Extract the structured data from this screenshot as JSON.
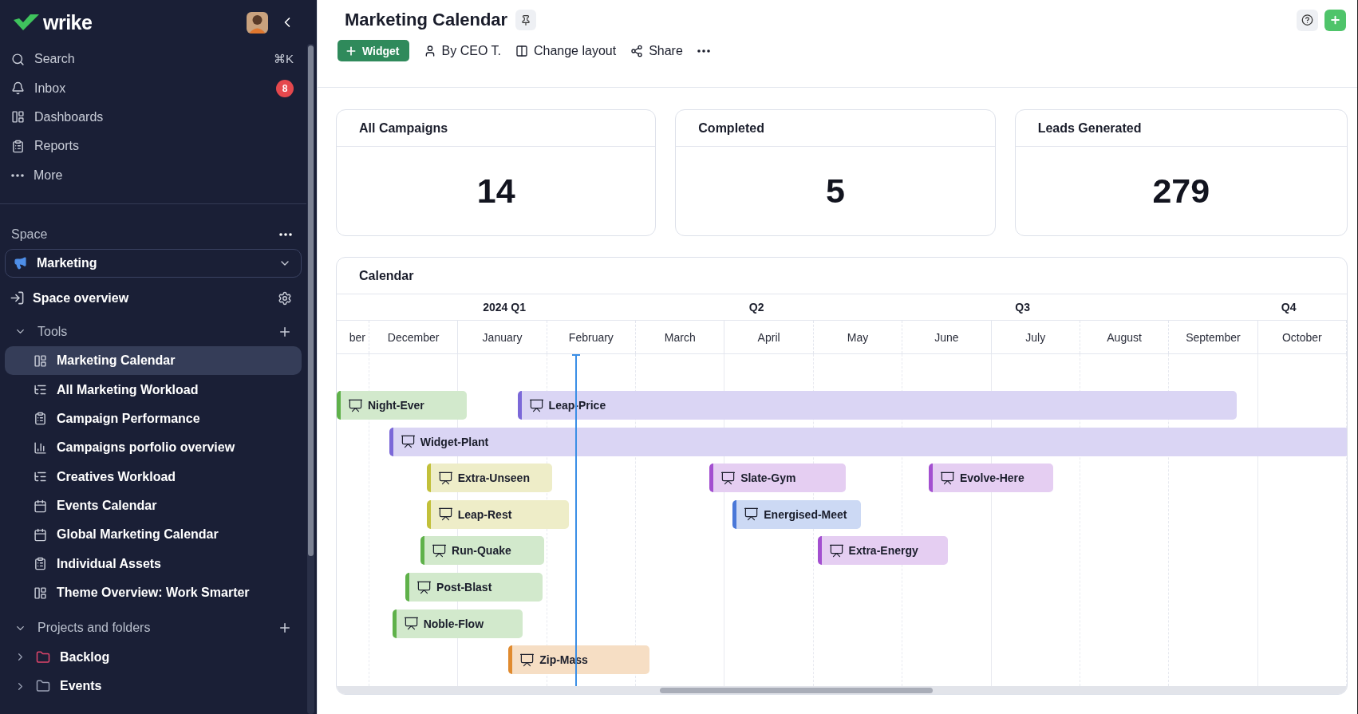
{
  "sidebar": {
    "logo": "wrike",
    "nav": [
      {
        "label": "Search",
        "shortcut": "⌘K"
      },
      {
        "label": "Inbox",
        "badge": "8"
      },
      {
        "label": "Dashboards"
      },
      {
        "label": "Reports"
      },
      {
        "label": "More"
      }
    ],
    "space": {
      "heading": "Space",
      "selector": "Marketing",
      "overview": "Space overview"
    },
    "tools": {
      "heading": "Tools",
      "expanded": true,
      "items": [
        {
          "label": "Marketing Calendar",
          "selected": true
        },
        {
          "label": "All Marketing Workload",
          "selected": false
        },
        {
          "label": "Campaign Performance",
          "selected": false
        },
        {
          "label": "Campaigns porfolio overview",
          "selected": false
        },
        {
          "label": "Creatives Workload",
          "selected": false
        },
        {
          "label": "Events Calendar",
          "selected": false
        },
        {
          "label": "Global Marketing Calendar",
          "selected": false
        },
        {
          "label": "Individual Assets",
          "selected": false
        },
        {
          "label": "Theme Overview: Work Smarter",
          "selected": false
        }
      ]
    },
    "projects": {
      "heading": "Projects and folders",
      "expanded": true,
      "items": [
        {
          "label": "Backlog",
          "expanded": false,
          "color": "#e0456b"
        },
        {
          "label": "Events",
          "expanded": false,
          "color": "#9aa1b5"
        }
      ]
    }
  },
  "header": {
    "title": "Marketing Calendar",
    "toolbar": [
      {
        "kind": "primary",
        "label": "Widget"
      },
      {
        "kind": "person",
        "label": "By CEO T."
      },
      {
        "kind": "layout",
        "label": "Change layout"
      },
      {
        "kind": "share",
        "label": "Share"
      },
      {
        "kind": "more"
      }
    ]
  },
  "stats": [
    {
      "title": "All Campaigns",
      "value": "14"
    },
    {
      "title": "Completed",
      "value": "5"
    },
    {
      "title": "Leads Generated",
      "value": "279"
    }
  ],
  "calendar": {
    "title": "Calendar",
    "quarters": [
      "2024 Q1",
      "Q2",
      "Q3",
      "Q4"
    ],
    "months": [
      "ber",
      "December",
      "January",
      "February",
      "March",
      "April",
      "May",
      "June",
      "July",
      "August",
      "September",
      "October"
    ],
    "rows": [
      {
        "bars": [
          {
            "label": "Night-Ever",
            "color": "#5fb14a"
          },
          {
            "label": "Leap-Price",
            "color": "#7b68d8"
          }
        ]
      },
      {
        "bars": [
          {
            "label": "Widget-Plant",
            "color": "#7b68d8"
          }
        ]
      },
      {
        "bars": [
          {
            "label": "Extra-Unseen",
            "color": "#c2c03a"
          },
          {
            "label": "Slate-Gym",
            "color": "#a34fd0"
          },
          {
            "label": "Evolve-Here",
            "color": "#a34fd0"
          }
        ]
      },
      {
        "bars": [
          {
            "label": "Leap-Rest",
            "color": "#c2c03a"
          },
          {
            "label": "Energised-Meet",
            "color": "#4a78d8"
          }
        ]
      },
      {
        "bars": [
          {
            "label": "Run-Quake",
            "color": "#5fb14a"
          },
          {
            "label": "Extra-Energy",
            "color": "#a34fd0"
          }
        ]
      },
      {
        "bars": [
          {
            "label": "Post-Blast",
            "color": "#5fb14a"
          }
        ]
      },
      {
        "bars": [
          {
            "label": "Noble-Flow",
            "color": "#5fb14a"
          }
        ]
      },
      {
        "bars": [
          {
            "label": "Zip-Mass",
            "color": "#e08a2e"
          }
        ]
      }
    ]
  }
}
